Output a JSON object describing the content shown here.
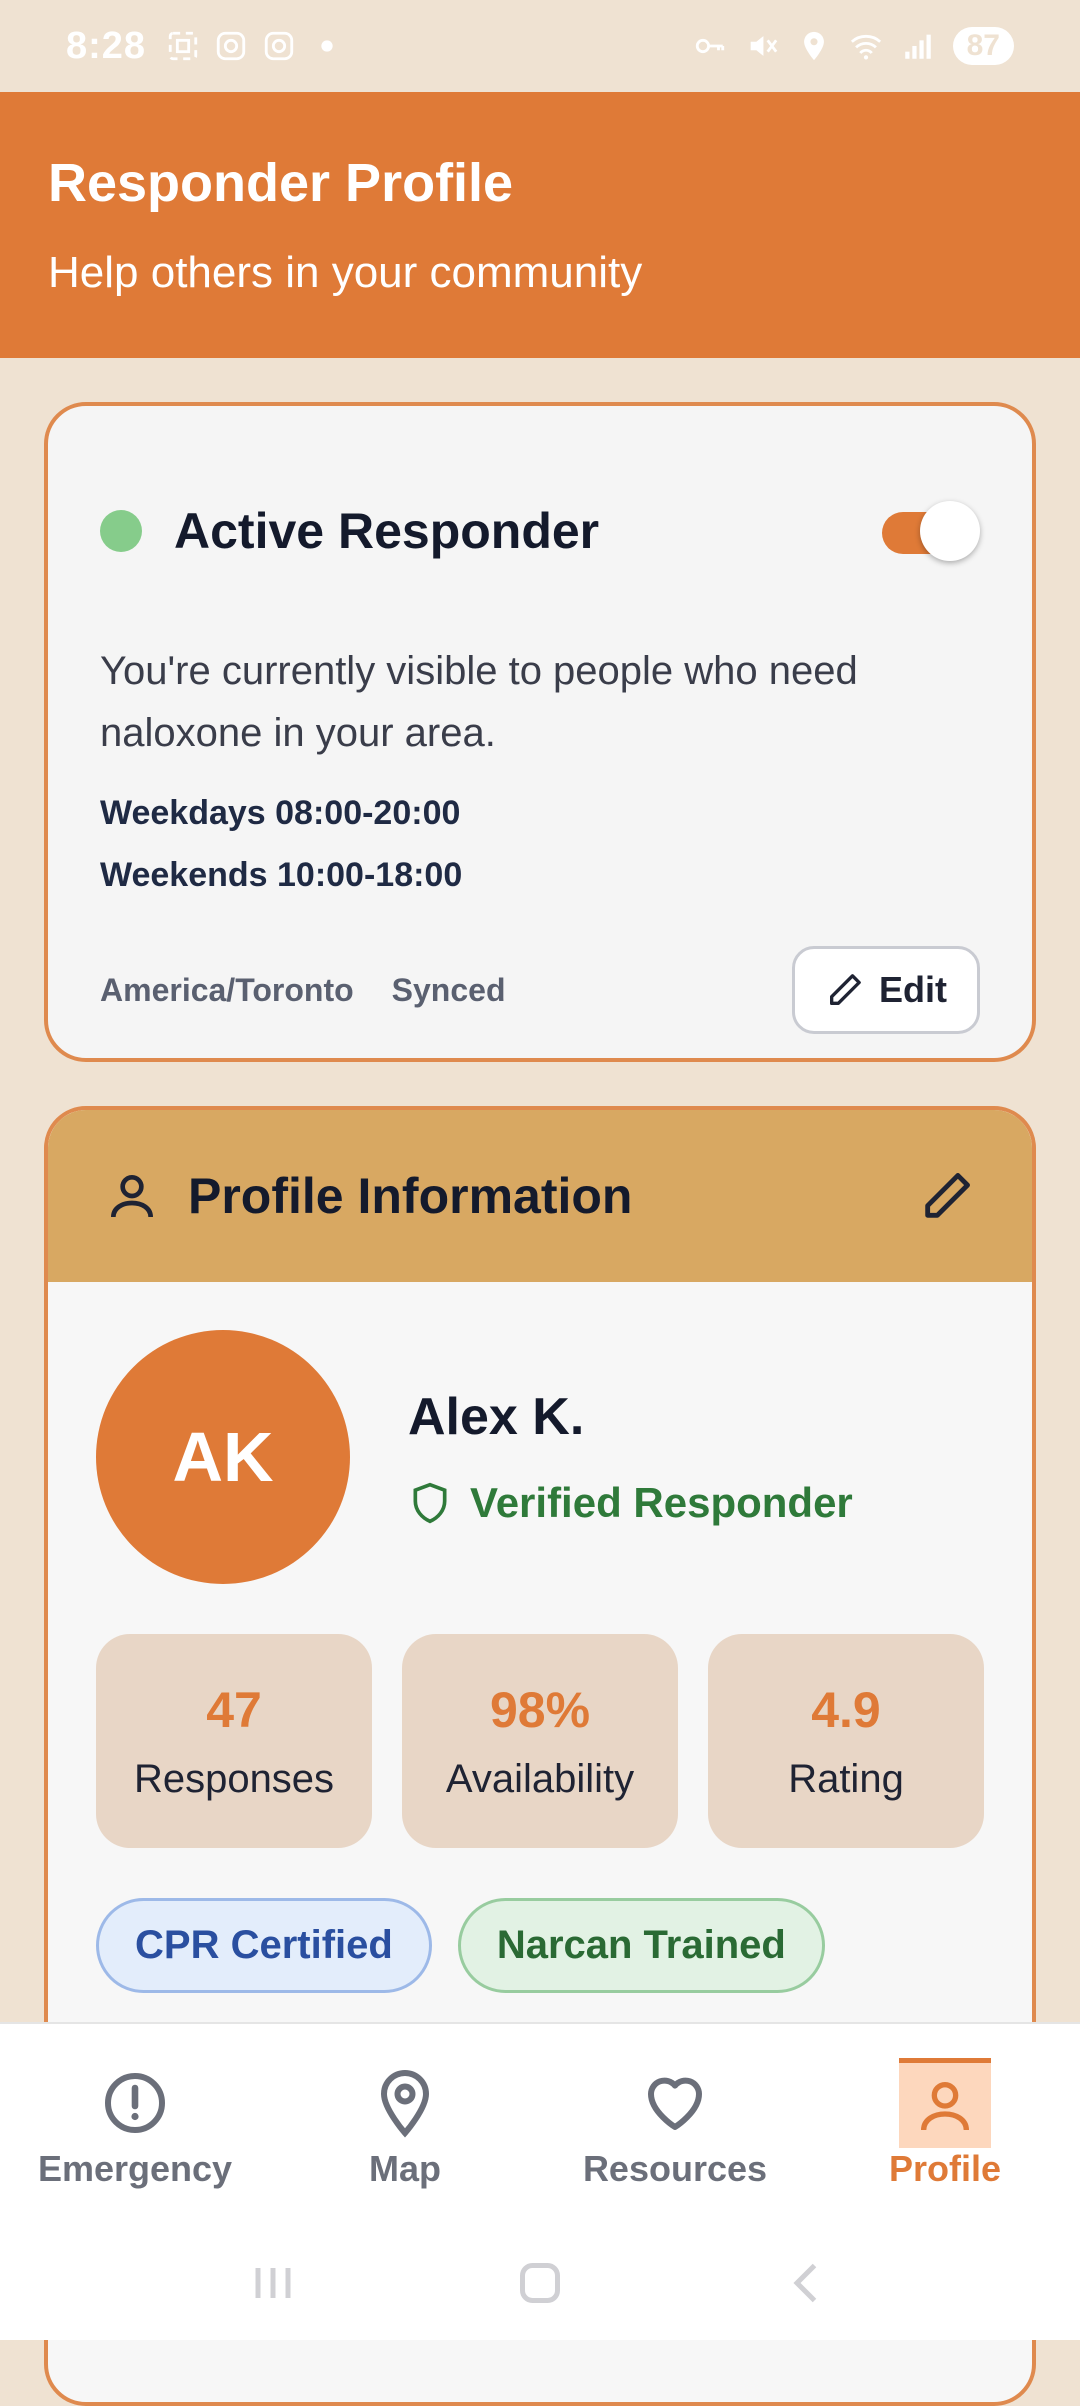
{
  "status_bar": {
    "time": "8:28",
    "battery": "87",
    "icons": [
      "screenshot-icon",
      "instagram-icon",
      "instagram-icon",
      "dot-icon",
      "key-icon",
      "mute-icon",
      "location-icon",
      "wifi-icon",
      "signal-icon"
    ]
  },
  "header": {
    "title": "Responder Profile",
    "subtitle": "Help others in your community"
  },
  "active_card": {
    "title": "Active Responder",
    "toggle_on": true,
    "description": "You're currently visible to people who need naloxone in your area.",
    "schedule": [
      "Weekdays 08:00-20:00",
      "Weekends 10:00-18:00"
    ],
    "timezone": "America/Toronto",
    "sync_status": "Synced",
    "edit_label": "Edit"
  },
  "profile_card": {
    "title": "Profile Information",
    "initials": "AK",
    "name": "Alex K.",
    "verified_label": "Verified Responder",
    "stats": [
      {
        "value": "47",
        "label": "Responses"
      },
      {
        "value": "98%",
        "label": "Availability"
      },
      {
        "value": "4.9",
        "label": "Rating"
      }
    ],
    "badges": [
      "CPR Certified",
      "Narcan Trained"
    ]
  },
  "bottom_nav": {
    "items": [
      {
        "label": "Emergency",
        "icon": "alert-circle-icon"
      },
      {
        "label": "Map",
        "icon": "map-pin-icon"
      },
      {
        "label": "Resources",
        "icon": "heart-icon"
      },
      {
        "label": "Profile",
        "icon": "user-icon",
        "active": true
      }
    ]
  },
  "colors": {
    "primary": "#df7a37",
    "background": "#efe2d2",
    "profile_header": "#d8a862",
    "success": "#2f7a3a"
  }
}
